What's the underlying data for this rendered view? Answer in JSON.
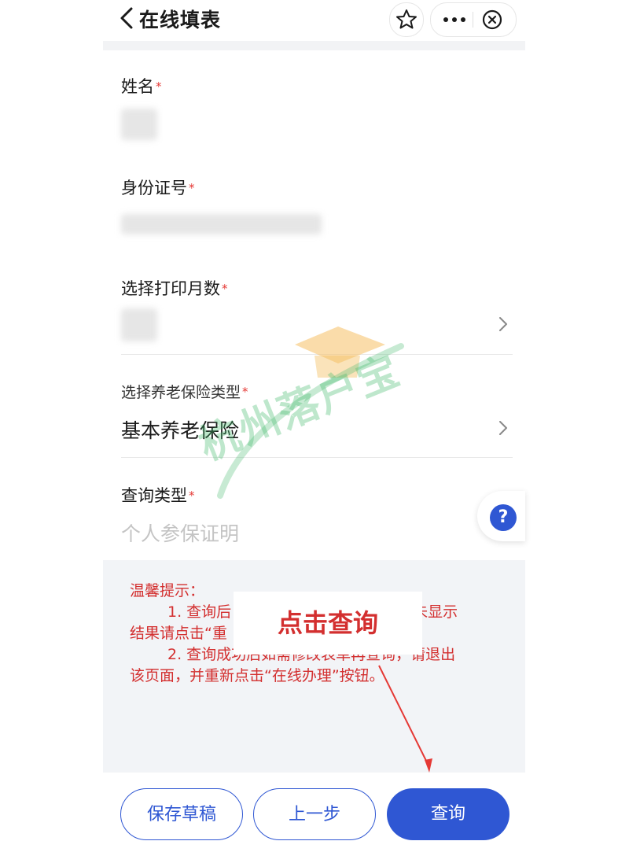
{
  "header": {
    "title": "在线填表",
    "icons": [
      "back-icon",
      "star-icon",
      "more-icon",
      "close-icon"
    ]
  },
  "form": {
    "name_label": "姓名",
    "id_label": "身份证号",
    "months_label": "选择打印月数",
    "pension_label": "选择养老保险类型",
    "pension_value": "基本养老保险",
    "query_label": "查询类型",
    "query_placeholder": "个人参保证明",
    "required_mark": "*"
  },
  "help": {
    "symbol": "?"
  },
  "tips": {
    "line1": "温馨提示：",
    "line2_a": "1. 查询后",
    "line2_b": "如未显示",
    "line3": "结果请点击“重",
    "line4": "2. 查询成功后如需修改表单再查询，请退出",
    "line5": "该页面，并重新点击“在线办理”按钮。"
  },
  "callout": {
    "text": "点击查询"
  },
  "watermark": {
    "text": "杭州落户宝"
  },
  "buttons": {
    "save_draft": "保存草稿",
    "prev": "上一步",
    "query": "查询"
  },
  "colors": {
    "primary": "#2f57d3",
    "required": "#e53935",
    "tip_red": "#d32f2f",
    "watermark_green": "#46b96e",
    "watermark_orange": "#f5c065"
  }
}
